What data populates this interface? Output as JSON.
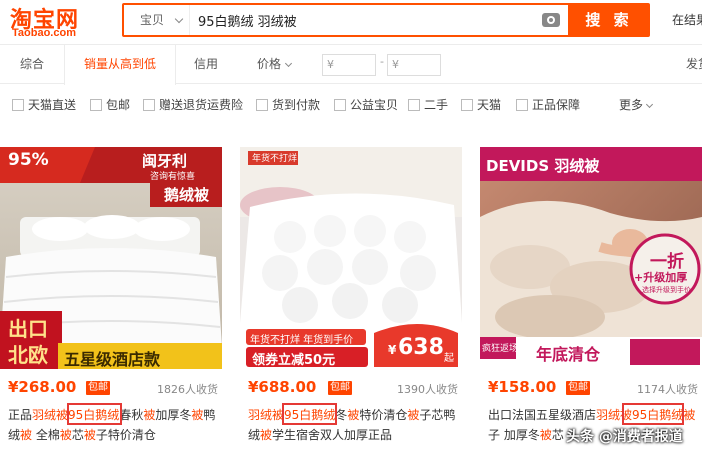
{
  "header": {
    "logo_main": "淘宝网",
    "logo_sub": "Taobao.com",
    "search_scope": "宝贝",
    "search_query": "95白鹅绒 羽绒被",
    "search_button": "搜 索",
    "in_result_search": "在结果"
  },
  "sortbar": {
    "tabs": [
      "综合",
      "销量从高到低",
      "信用"
    ],
    "active_tab": "销量从高到低",
    "price_label": "价格",
    "price_min_placeholder": "¥",
    "price_max_placeholder": "¥",
    "price_dash": "-",
    "ship_to": "发货"
  },
  "filters": {
    "items": [
      "天猫直送",
      "包邮",
      "赠送退货运费险",
      "货到付款",
      "公益宝贝",
      "二手",
      "天猫",
      "正品保障"
    ],
    "more": "更多"
  },
  "products": [
    {
      "image_text": {
        "percent": "95%",
        "brand": "闽牙利",
        "promo": "咨询有惊喜",
        "type": "鹅绒被",
        "export1": "出口",
        "export2": "北欧",
        "hotel": "五星级酒店款"
      },
      "price": "¥268.00",
      "free_shipping": "包邮",
      "sales": "1826人收货",
      "title_segments": [
        {
          "t": "正品",
          "hl": false
        },
        {
          "t": "羽绒被",
          "hl": true
        },
        {
          "t": "95白鹅绒",
          "hl": true
        },
        {
          "t": "春秋",
          "hl": false
        },
        {
          "t": "被",
          "hl": true
        },
        {
          "t": "加厚冬",
          "hl": false
        },
        {
          "t": "被",
          "hl": true
        },
        {
          "t": "鸭绒",
          "hl": false
        },
        {
          "t": "被",
          "hl": true
        },
        {
          "t": " 全棉",
          "hl": false
        },
        {
          "t": "被",
          "hl": true
        },
        {
          "t": "芯",
          "hl": false
        },
        {
          "t": "被",
          "hl": true
        },
        {
          "t": "子特价清仓",
          "hl": false
        }
      ]
    },
    {
      "image_text": {
        "tag": "年货不打烊",
        "tag2": "年货不打烊 年货到手价",
        "coupon": "领券立减50元",
        "price_prefix": "¥",
        "price_big": "638",
        "price_suffix": "起"
      },
      "price": "¥688.00",
      "free_shipping": "包邮",
      "sales": "1390人收货",
      "title_segments": [
        {
          "t": "羽绒被",
          "hl": true
        },
        {
          "t": "95白鹅绒",
          "hl": true
        },
        {
          "t": "冬",
          "hl": false
        },
        {
          "t": "被",
          "hl": true
        },
        {
          "t": "特价清仓",
          "hl": false
        },
        {
          "t": "被",
          "hl": true
        },
        {
          "t": "子",
          "hl": false
        },
        {
          "t": "芯鸭绒",
          "hl": false
        },
        {
          "t": "被",
          "hl": true
        },
        {
          "t": "学生宿舍双人加厚正品",
          "hl": false
        }
      ]
    },
    {
      "image_text": {
        "brand": "DEVIDS 羽绒被",
        "badge1": "一折",
        "badge2": "+升级加厚",
        "badge3": "选择升级到手价",
        "sale": "年底清仓",
        "corner": "疯狂返场"
      },
      "price": "¥158.00",
      "free_shipping": "包邮",
      "sales": "1174人收货",
      "title_segments": [
        {
          "t": "出口法国五星级酒店",
          "hl": false
        },
        {
          "t": "羽绒被",
          "hl": true
        },
        {
          "t": "95白鹅绒",
          "hl": true
        },
        {
          "t": "被",
          "hl": true
        },
        {
          "t": "子 加厚冬",
          "hl": false
        },
        {
          "t": "被",
          "hl": true
        },
        {
          "t": "芯",
          "hl": false
        }
      ]
    }
  ],
  "watermark": "头条 @消费者报道",
  "colors": {
    "brand_orange": "#ff4400",
    "search_orange": "#ff5000",
    "annotation_red": "#e53935"
  }
}
